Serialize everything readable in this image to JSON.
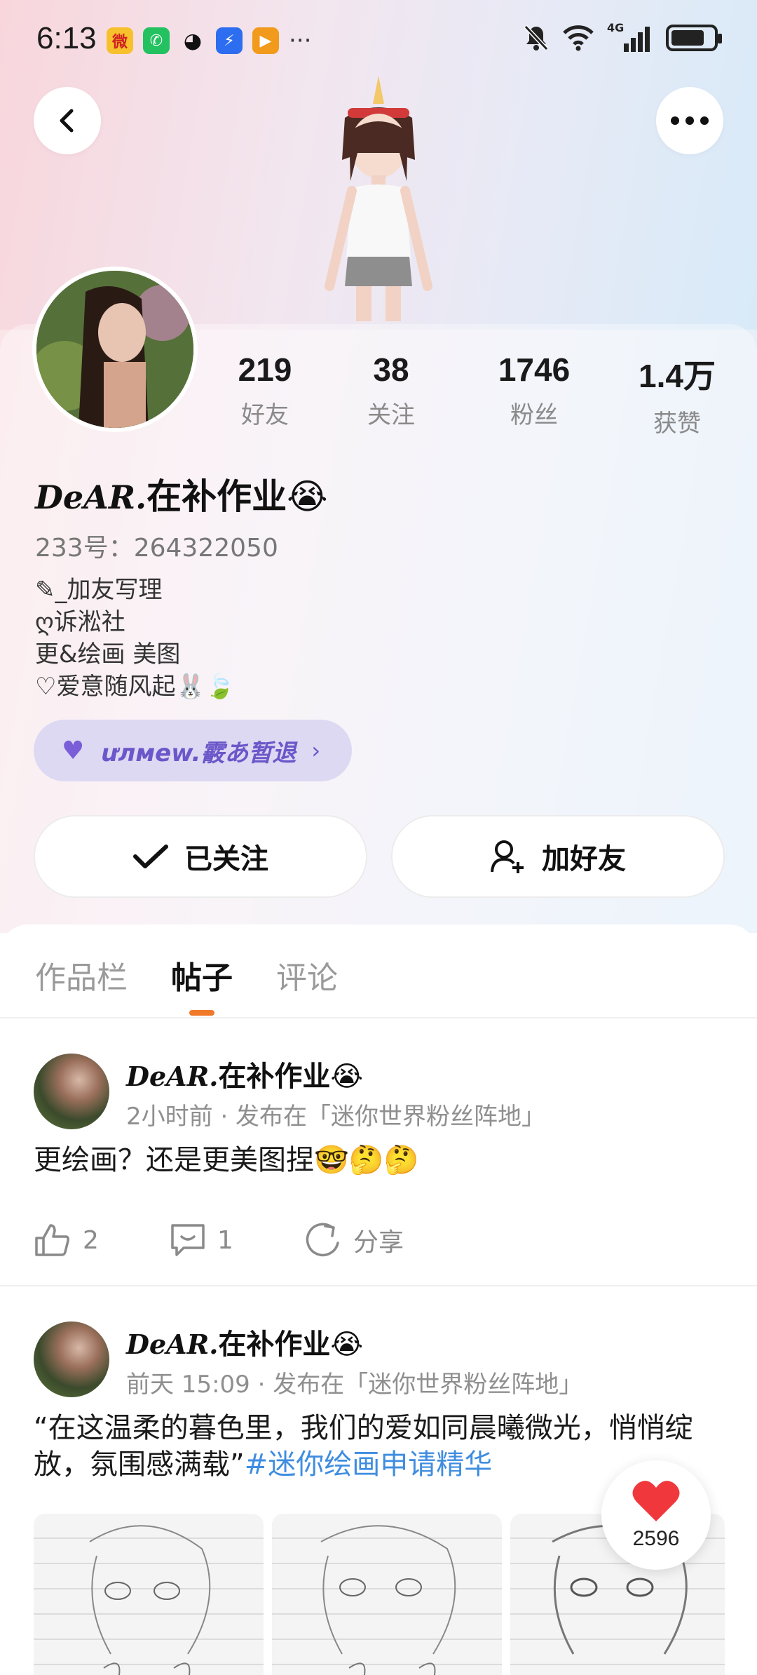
{
  "status_bar": {
    "time": "6:13",
    "apps": [
      "weibo-icon",
      "wechat-icon",
      "qq-icon",
      "app-icon-blue",
      "app-icon-orange"
    ],
    "more": "···",
    "network": "4G"
  },
  "profile": {
    "stats": [
      {
        "value": "219",
        "label": "好友"
      },
      {
        "value": "38",
        "label": "关注"
      },
      {
        "value": "1746",
        "label": "粉丝"
      },
      {
        "value": "1.4万",
        "label": "获赞"
      }
    ],
    "nickname_script": "DeAR.",
    "nickname": "在补作业",
    "nickname_emoji": "😭",
    "uid": "233号：264322050",
    "bio": [
      "✎_加友写理",
      "ღ诉淞社",
      "更&绘画 美图",
      "♡爱意随风起🐰🍃"
    ],
    "group_tag": "ưлмew.霰あ暂退",
    "buttons": {
      "followed": "已关注",
      "add_friend": "加好友"
    }
  },
  "tabs": [
    {
      "label": "作品栏",
      "active": false
    },
    {
      "label": "帖子",
      "active": true
    },
    {
      "label": "评论",
      "active": false
    }
  ],
  "posts": [
    {
      "author_script": "DeAR.",
      "author": "在补作业😭",
      "meta": "2小时前 · 发布在「迷你世界粉丝阵地」",
      "text": "更绘画？还是更美图捏🤓🤔🤔",
      "likes": "2",
      "comments": "1",
      "share": "分享"
    },
    {
      "author_script": "DeAR.",
      "author": "在补作业😭",
      "meta": "前天 15:09 · 发布在「迷你世界粉丝阵地」",
      "text": "“在这温柔的暮色里，我们的爱如同晨曦微光，悄悄绽放，氛围感满载”",
      "hashtag": "#迷你绘画申请精华"
    }
  ],
  "floating_like": {
    "count": "2596"
  },
  "colors": {
    "accent": "#f07a2a",
    "hashtag": "#3f8de0",
    "group_pill": "#ddd9f3"
  }
}
